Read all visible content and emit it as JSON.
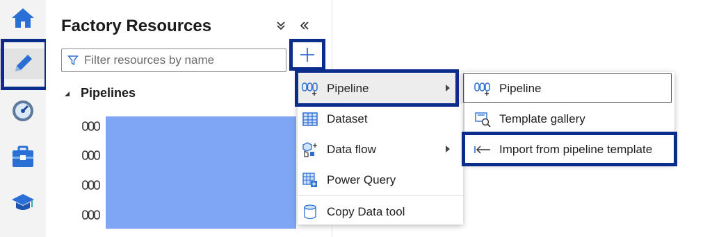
{
  "rail": {
    "items": [
      {
        "name": "home",
        "icon": "home-icon"
      },
      {
        "name": "author",
        "icon": "pencil-icon",
        "selected": true
      },
      {
        "name": "monitor",
        "icon": "gauge-icon"
      },
      {
        "name": "manage",
        "icon": "toolbox-icon"
      },
      {
        "name": "learning",
        "icon": "graduation-cap-icon"
      }
    ]
  },
  "panel": {
    "title": "Factory Resources",
    "collapse_all_icon": "chevron-double-down-icon",
    "hide_panel_icon": "chevron-double-left-icon",
    "filter": {
      "placeholder": "Filter resources by name",
      "value": ""
    },
    "add_icon": "plus-icon",
    "pipelines_label": "Pipelines",
    "pipeline_items_count_shown": 4
  },
  "menu": {
    "items": [
      {
        "label": "Pipeline",
        "icon": "pipeline-icon",
        "has_submenu": true
      },
      {
        "label": "Dataset",
        "icon": "table-icon",
        "has_submenu": false
      },
      {
        "label": "Data flow",
        "icon": "dataflow-icon",
        "has_submenu": true
      },
      {
        "label": "Power Query",
        "icon": "power-query-icon",
        "has_submenu": false
      },
      {
        "label": "Copy Data tool",
        "icon": "cylinder-icon",
        "has_submenu": false
      }
    ]
  },
  "submenu": {
    "items": [
      {
        "label": "Pipeline",
        "icon": "pipeline-icon"
      },
      {
        "label": "Template gallery",
        "icon": "template-gallery-icon"
      },
      {
        "label": "Import from pipeline template",
        "icon": "import-arrow-icon"
      }
    ]
  },
  "colors": {
    "highlight": "#0a2d8c",
    "azure_blue": "#0078d4",
    "redacted": "#7fa6f5"
  }
}
